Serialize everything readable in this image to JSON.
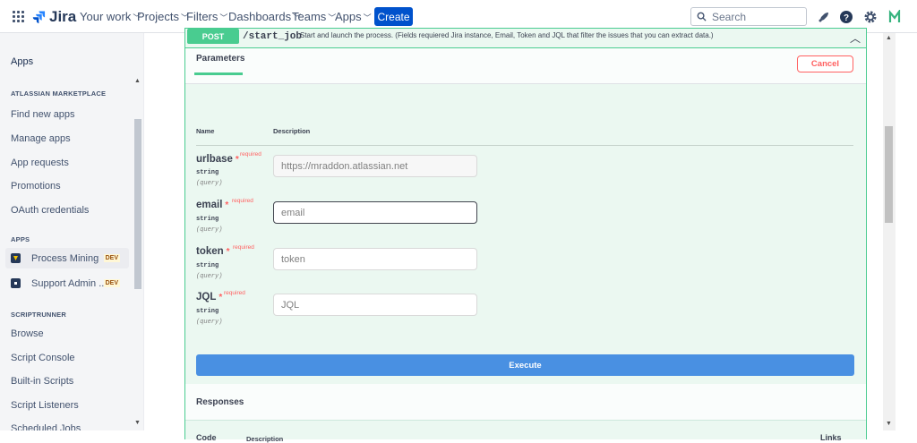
{
  "topbar": {
    "product": "Jira",
    "nav": [
      {
        "label": "Your work"
      },
      {
        "label": "Projects"
      },
      {
        "label": "Filters"
      },
      {
        "label": "Dashboards"
      },
      {
        "label": "Teams"
      },
      {
        "label": "Apps"
      }
    ],
    "create_label": "Create",
    "search_placeholder": "Search"
  },
  "sidebar": {
    "title": "Apps",
    "sections": {
      "marketplace": {
        "heading": "ATLASSIAN MARKETPLACE",
        "items": [
          "Find new apps",
          "Manage apps",
          "App requests",
          "Promotions",
          "OAuth credentials"
        ]
      },
      "apps": {
        "heading": "APPS",
        "items": [
          {
            "label": "Process Mining",
            "badge": "DEV",
            "active": true,
            "icon_color": "#f5c400"
          },
          {
            "label": "Support Admin ...",
            "badge": "DEV",
            "active": false,
            "icon_color": "#253858"
          }
        ]
      },
      "scriptrunner": {
        "heading": "SCRIPTRUNNER",
        "items": [
          "Browse",
          "Script Console",
          "Built-in Scripts",
          "Script Listeners",
          "Scheduled Jobs"
        ]
      }
    }
  },
  "operation": {
    "method": "POST",
    "path": "/start_job",
    "summary": "Start and launch the process. (Fields requiered Jira instance, Email, Token and JQL that filter the issues that you can extract data.)",
    "params_title": "Parameters",
    "cancel_label": "Cancel",
    "col_name": "Name",
    "col_description": "Description",
    "params": [
      {
        "name": "urlbase",
        "required": "required",
        "type": "string",
        "in": "(query)",
        "value": "https://mraddon.atlassian.net",
        "disabled": true
      },
      {
        "name": "email",
        "required": "required",
        "type": "string",
        "in": "(query)",
        "placeholder": "email",
        "focused": true
      },
      {
        "name": "token",
        "required": "required",
        "type": "string",
        "in": "(query)",
        "placeholder": "token"
      },
      {
        "name": "JQL",
        "required": "required",
        "type": "string",
        "in": "(query)",
        "placeholder": "JQL"
      }
    ],
    "execute_label": "Execute",
    "responses_title": "Responses",
    "resp_code": "Code",
    "resp_description": "Description",
    "resp_links": "Links"
  },
  "colors": {
    "post": "#49cc90",
    "execute": "#4990e2",
    "cancel": "#ff6060",
    "create": "#0052cc"
  }
}
